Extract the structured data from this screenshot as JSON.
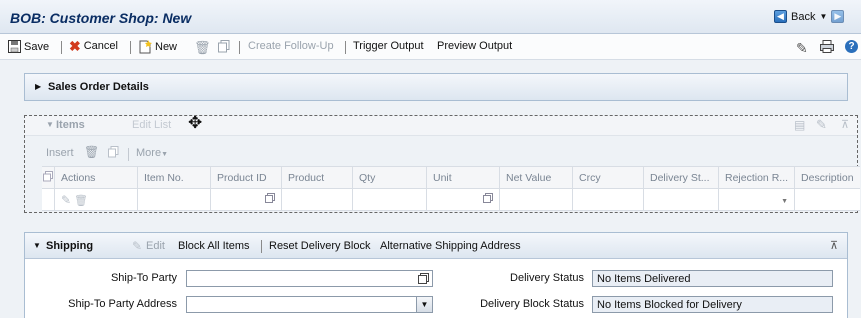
{
  "window": {
    "title": "BOB: Customer Shop: New",
    "back_label": "Back"
  },
  "toolbar": {
    "save": "Save",
    "cancel": "Cancel",
    "new": "New",
    "create_follow_up": "Create Follow-Up",
    "trigger_output": "Trigger Output",
    "preview_output": "Preview Output"
  },
  "sales_order": {
    "title": "Sales Order Details"
  },
  "items": {
    "title": "Items",
    "edit_list": "Edit List",
    "insert": "Insert",
    "more": "More",
    "columns": [
      "Actions",
      "Item No.",
      "Product ID",
      "Product",
      "Qty",
      "Unit",
      "Net Value",
      "Crcy",
      "Delivery St...",
      "Rejection R...",
      "Description"
    ]
  },
  "shipping": {
    "title": "Shipping",
    "edit": "Edit",
    "block_all": "Block All Items",
    "reset_block": "Reset Delivery Block",
    "alt_address": "Alternative Shipping Address",
    "ship_to_party_label": "Ship-To Party",
    "ship_to_party_value": "",
    "ship_to_address_label": "Ship-To Party Address",
    "ship_to_address_value": "",
    "delivery_status_label": "Delivery Status",
    "delivery_status_value": "No Items Delivered",
    "delivery_block_label": "Delivery Block Status",
    "delivery_block_value": "No Items Blocked for Delivery"
  },
  "colors": {
    "title": "#0a2d63",
    "accent": "#2a6fbb",
    "cancel": "#d23a1d"
  }
}
